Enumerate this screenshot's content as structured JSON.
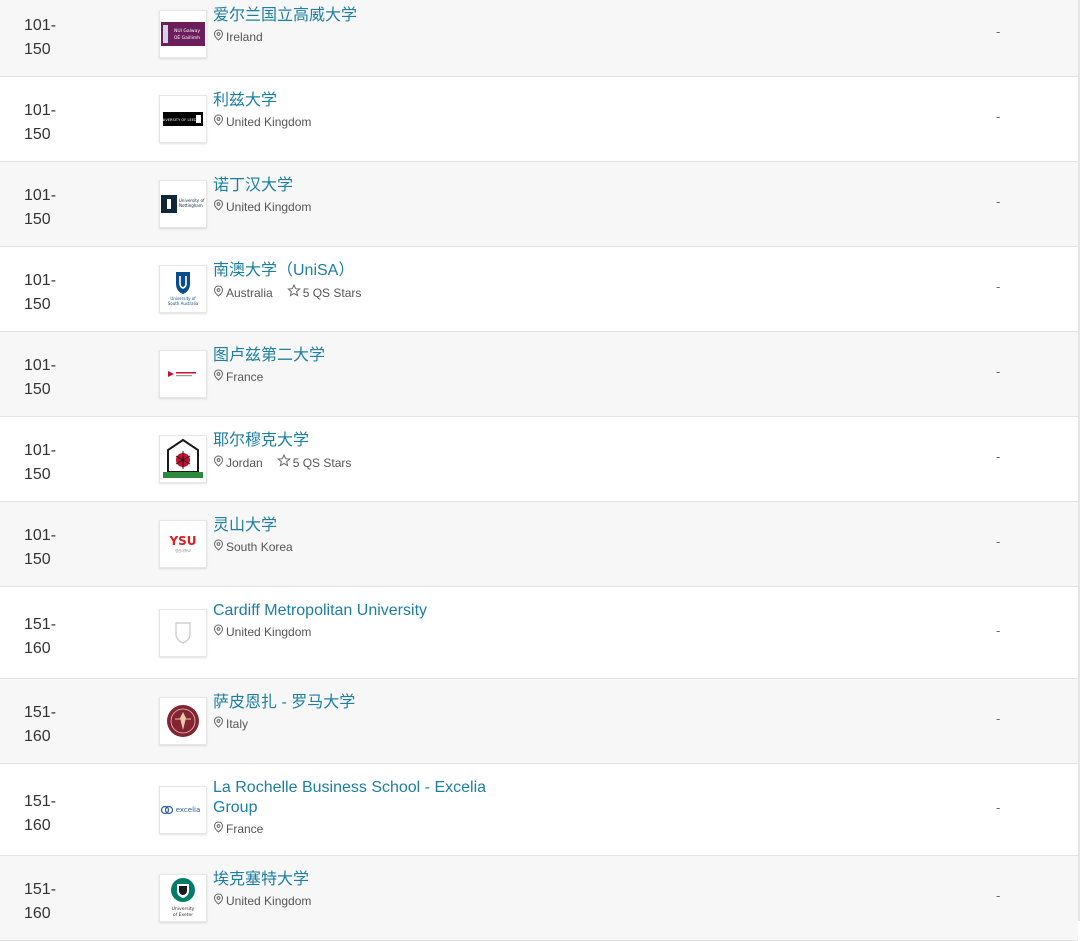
{
  "rows": [
    {
      "rank": "101-\n150",
      "name": "爱尔兰国立高威大学",
      "country": "Ireland",
      "stars": null,
      "score": "-",
      "logo": "galway-logo-icon"
    },
    {
      "rank": "101-\n150",
      "name": "利兹大学",
      "country": "United Kingdom",
      "stars": null,
      "score": "-",
      "logo": "leeds-logo-icon"
    },
    {
      "rank": "101-\n150",
      "name": "诺丁汉大学",
      "country": "United Kingdom",
      "stars": null,
      "score": "-",
      "logo": "nottingham-logo-icon"
    },
    {
      "rank": "101-\n150",
      "name": "南澳大学（UniSA）",
      "country": "Australia",
      "stars": "5 QS Stars",
      "score": "-",
      "logo": "unisa-logo-icon"
    },
    {
      "rank": "101-\n150",
      "name": "图卢兹第二大学",
      "country": "France",
      "stars": null,
      "score": "-",
      "logo": "toulouse-logo-icon"
    },
    {
      "rank": "101-\n150",
      "name": "耶尔穆克大学",
      "country": "Jordan",
      "stars": "5 QS Stars",
      "score": "-",
      "logo": "yarmouk-logo-icon"
    },
    {
      "rank": "101-\n150",
      "name": "灵山大学",
      "country": "South Korea",
      "stars": null,
      "score": "-",
      "logo": "ysu-logo-icon"
    },
    {
      "rank": "151-\n160",
      "name": "Cardiff Metropolitan University",
      "country": "United Kingdom",
      "stars": null,
      "score": "-",
      "logo": "shield-placeholder-icon"
    },
    {
      "rank": "151-\n160",
      "name": "萨皮恩扎 - 罗马大学",
      "country": "Italy",
      "stars": null,
      "score": "-",
      "logo": "sapienza-logo-icon"
    },
    {
      "rank": "151-\n160",
      "name": "La Rochelle Business School - Excelia Group",
      "country": "France",
      "stars": null,
      "score": "-",
      "logo": "excelia-logo-icon"
    },
    {
      "rank": "151-\n160",
      "name": "埃克塞特大学",
      "country": "United Kingdom",
      "stars": null,
      "score": "-",
      "logo": "exeter-logo-icon"
    }
  ],
  "logo_text": {
    "galway": "NUI Galway\nOÉ Gaillimh",
    "leeds": "UNIVERSITY OF LEEDS",
    "nottingham": "University of\nNottingham",
    "unisa": "University of\nSouth Australia",
    "ysu": "YSU",
    "ysu_sub": "영산대학교",
    "excelia": "excelia",
    "exeter": "University\nof Exeter"
  },
  "colors": {
    "link": "#1b7ea3",
    "text": "#333333",
    "border": "#e3e3e3",
    "alt_row": "#f7f7f7",
    "galway_purple": "#6b1d5c",
    "nottingham_blue": "#10263b",
    "unisa_blue": "#0b4d8c",
    "sapienza_red": "#822433",
    "exeter_green": "#007d69",
    "ysu_red": "#e31b23"
  }
}
